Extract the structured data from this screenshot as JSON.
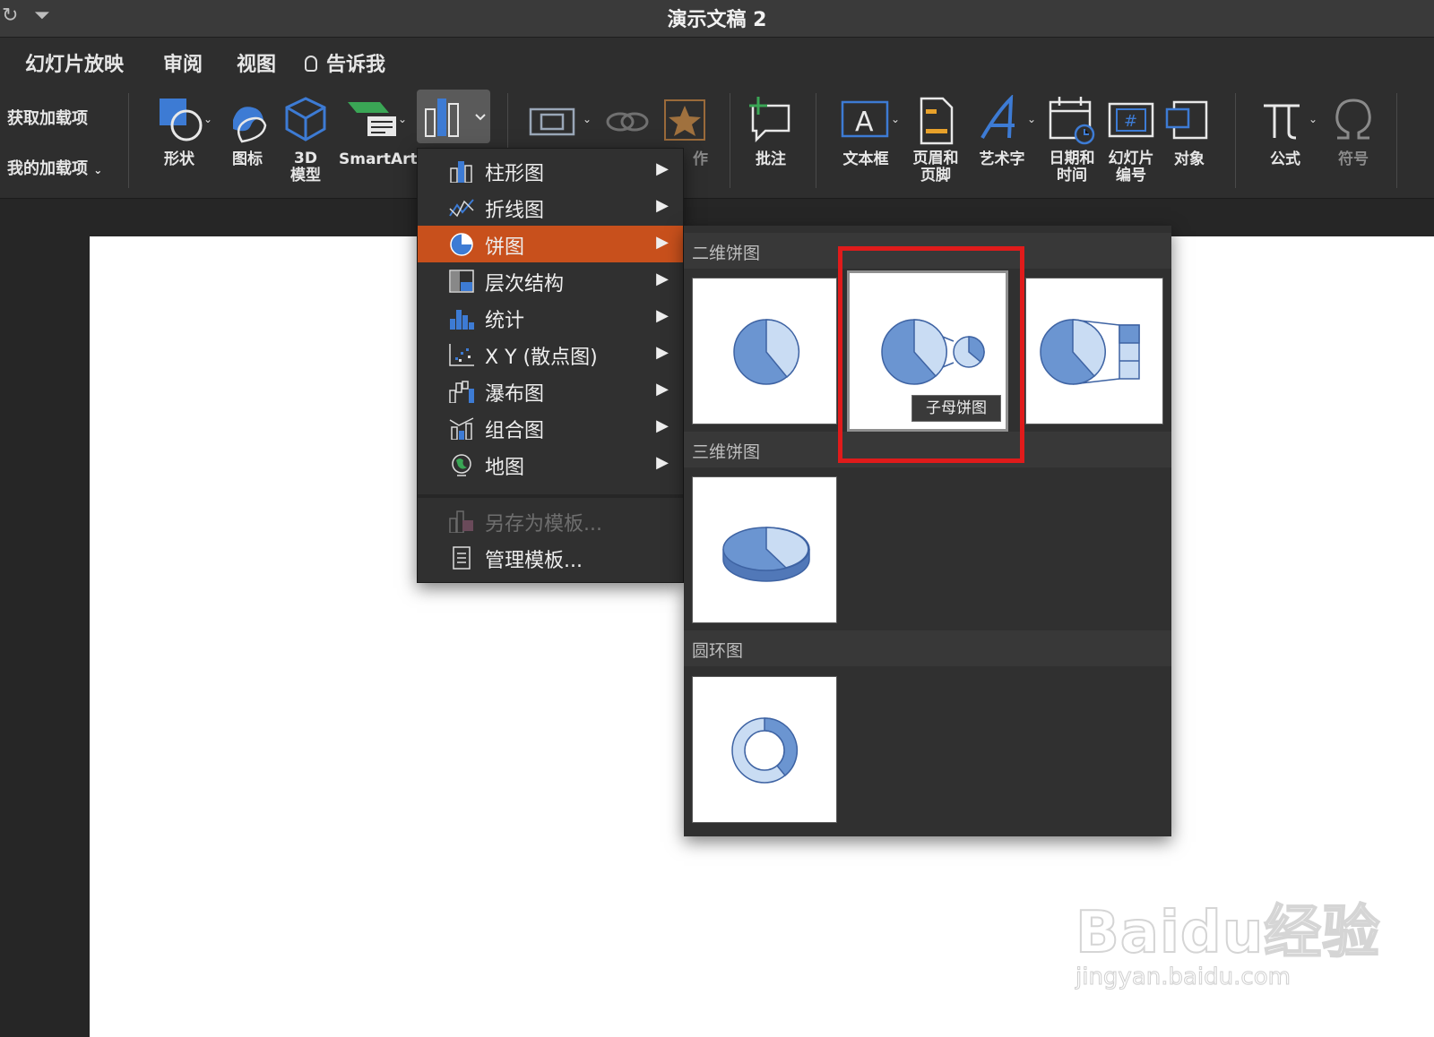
{
  "window": {
    "title": "演示文稿 2"
  },
  "menubar": {
    "items": [
      "幻灯片放映",
      "审阅",
      "视图"
    ],
    "tell_me": "告诉我"
  },
  "ribbon": {
    "addins": {
      "get": "获取加载项",
      "mine": "我的加载项"
    },
    "shapes": "形状",
    "icons": "图标",
    "model_3d": [
      "3D",
      "模型"
    ],
    "smartart": "SmartArt",
    "action_partial": "作",
    "comment": "批注",
    "textbox": "文本框",
    "header_footer": [
      "页眉和",
      "页脚"
    ],
    "wordart": "艺术字",
    "date_time": [
      "日期和",
      "时间"
    ],
    "slide_number": [
      "幻灯片",
      "编号"
    ],
    "object": "对象",
    "equation": "公式",
    "symbol": "符号"
  },
  "chart_menu": {
    "items": [
      {
        "label": "柱形图",
        "icon": "column-chart-icon"
      },
      {
        "label": "折线图",
        "icon": "line-chart-icon"
      },
      {
        "label": "饼图",
        "icon": "pie-chart-icon",
        "selected": true
      },
      {
        "label": "层次结构",
        "icon": "hierarchy-chart-icon"
      },
      {
        "label": "统计",
        "icon": "statistic-chart-icon"
      },
      {
        "label": "X Y (散点图)",
        "icon": "scatter-chart-icon"
      },
      {
        "label": "瀑布图",
        "icon": "waterfall-chart-icon"
      },
      {
        "label": "组合图",
        "icon": "combo-chart-icon"
      },
      {
        "label": "地图",
        "icon": "map-chart-icon"
      }
    ],
    "save_template": "另存为模板...",
    "manage_templates": "管理模板..."
  },
  "pie_gallery": {
    "section_2d": "二维饼图",
    "section_3d": "三维饼图",
    "section_doughnut": "圆环图",
    "tooltip": "子母饼图"
  },
  "watermark": {
    "main": "Baidu经验",
    "url": "jingyan.baidu.com"
  },
  "colors": {
    "accent": "#c8501c",
    "highlight": "#e01b1b",
    "pie_dark": "#6b95d1",
    "pie_light": "#c9dcf3"
  }
}
